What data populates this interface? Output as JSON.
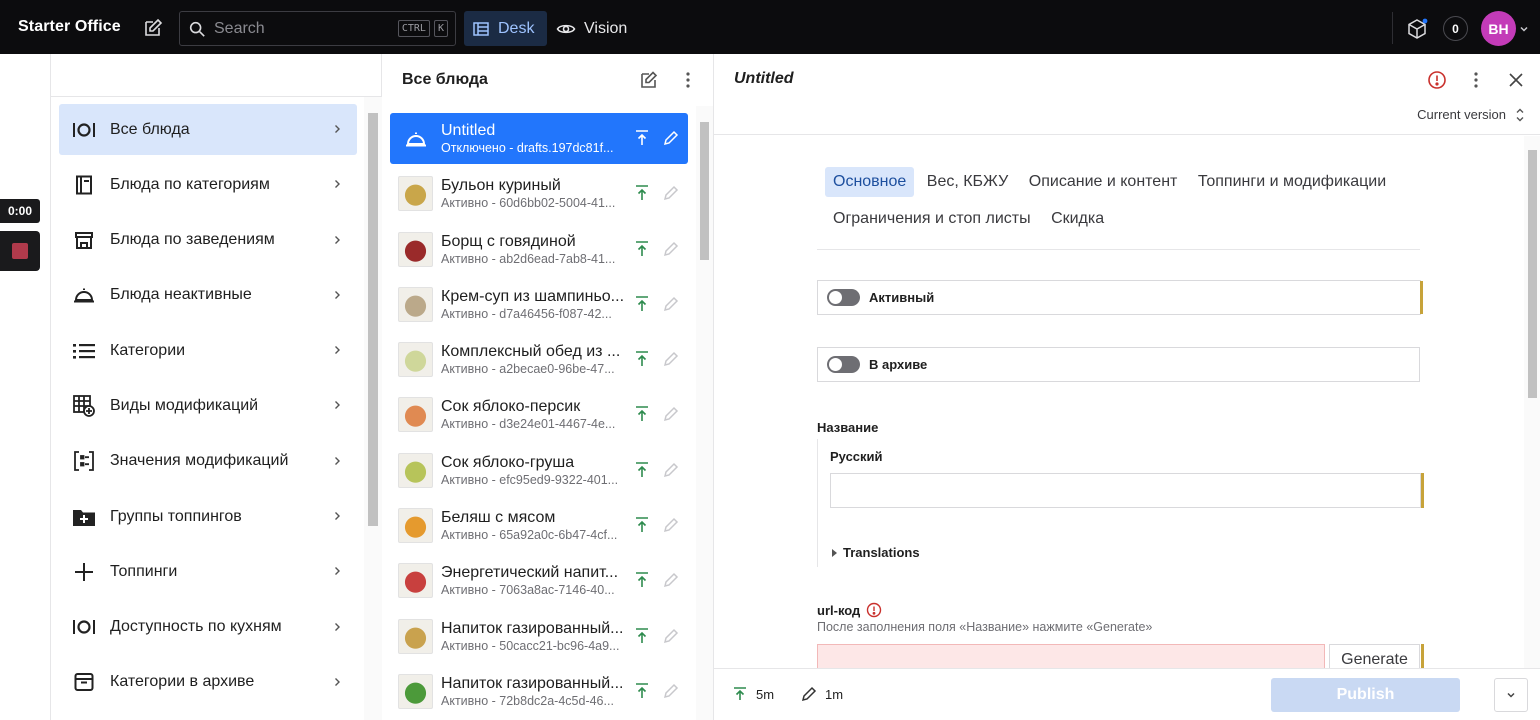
{
  "app": {
    "brand": "Starter Office",
    "search_placeholder": "Search",
    "shortcut_keys": [
      "CTRL",
      "K"
    ],
    "tools": [
      {
        "label": "Desk",
        "active": true
      },
      {
        "label": "Vision",
        "active": false
      }
    ],
    "notification_count": "0",
    "user_initials": "BH"
  },
  "recorder": {
    "time": "0:00"
  },
  "structure": {
    "items": [
      {
        "label": "Все блюда",
        "icon": "dish-icon",
        "active": true
      },
      {
        "label": "Блюда по категориям",
        "icon": "book-icon",
        "active": false
      },
      {
        "label": "Блюда по заведениям",
        "icon": "store-icon",
        "active": false
      },
      {
        "label": "Блюда неактивные",
        "icon": "cloche-icon",
        "active": false
      },
      {
        "label": "Категории",
        "icon": "list-icon",
        "active": false
      },
      {
        "label": "Виды модификаций",
        "icon": "table-add-icon",
        "active": false
      },
      {
        "label": "Значения модификаций",
        "icon": "modifiers-icon",
        "active": false
      },
      {
        "label": "Группы топпингов",
        "icon": "folder-add-icon",
        "active": false
      },
      {
        "label": "Топпинги",
        "icon": "plus-icon",
        "active": false
      },
      {
        "label": "Доступность по кухням",
        "icon": "dish-icon",
        "active": false
      },
      {
        "label": "Категории в архиве",
        "icon": "archive-icon",
        "active": false
      }
    ]
  },
  "doclist": {
    "title": "Все блюда",
    "items": [
      {
        "title": "Untitled",
        "subtitle": "Отключено - drafts.197dc81f...",
        "thumb": "cloche",
        "active": true
      },
      {
        "title": "Бульон куриный",
        "subtitle": "Активно - 60d6bb02-5004-41...",
        "thumb": "#c9a64a",
        "active": false
      },
      {
        "title": "Борщ с говядиной",
        "subtitle": "Активно - ab2d6ead-7ab8-41...",
        "thumb": "#9a2a2a",
        "active": false
      },
      {
        "title": "Крем-суп из шампиньо...",
        "subtitle": "Активно - d7a46456-f087-42...",
        "thumb": "#bba98a",
        "active": false
      },
      {
        "title": "Комплексный обед из ...",
        "subtitle": "Активно - a2becae0-96be-47...",
        "thumb": "#cfd79a",
        "active": false
      },
      {
        "title": "Сок яблоко-персик",
        "subtitle": "Активно - d3e24e01-4467-4e...",
        "thumb": "#e08a52",
        "active": false
      },
      {
        "title": "Сок яблоко-груша",
        "subtitle": "Активно - efc95ed9-9322-401...",
        "thumb": "#b7c45a",
        "active": false
      },
      {
        "title": "Беляш с мясом",
        "subtitle": "Активно - 65a92a0c-6b47-4cf...",
        "thumb": "#e59a2e",
        "active": false
      },
      {
        "title": "Энергетический напит...",
        "subtitle": "Активно - 7063a8ac-7146-40...",
        "thumb": "#c8403e",
        "active": false
      },
      {
        "title": "Напиток газированный...",
        "subtitle": "Активно - 50cacc21-bc96-4a9...",
        "thumb": "#c9a24e",
        "active": false
      },
      {
        "title": "Напиток газированный...",
        "subtitle": "Активно - 72b8dc2a-4c5d-46...",
        "thumb": "#4c9a3a",
        "active": false
      }
    ]
  },
  "editor": {
    "title": "Untitled",
    "version_label": "Current version",
    "tabs": [
      {
        "label": "Основное",
        "active": true
      },
      {
        "label": "Вес, КБЖУ",
        "active": false
      },
      {
        "label": "Описание и контент",
        "active": false
      },
      {
        "label": "Топпинги и модификации",
        "active": false
      },
      {
        "label": "Ограничения и стоп листы",
        "active": false
      },
      {
        "label": "Скидка",
        "active": false
      }
    ],
    "fields": {
      "active_label": "Активный",
      "archive_label": "В архиве",
      "name_label": "Название",
      "name_lang_label": "Русский",
      "name_value": "",
      "translations_label": "Translations",
      "url_label": "url-код",
      "url_help": "После заполнения поля «Название» нажмите «Generate»",
      "url_value": "",
      "generate_label": "Generate"
    },
    "footer": {
      "published_ago": "5m",
      "edited_ago": "1m",
      "publish_label": "Publish"
    }
  }
}
